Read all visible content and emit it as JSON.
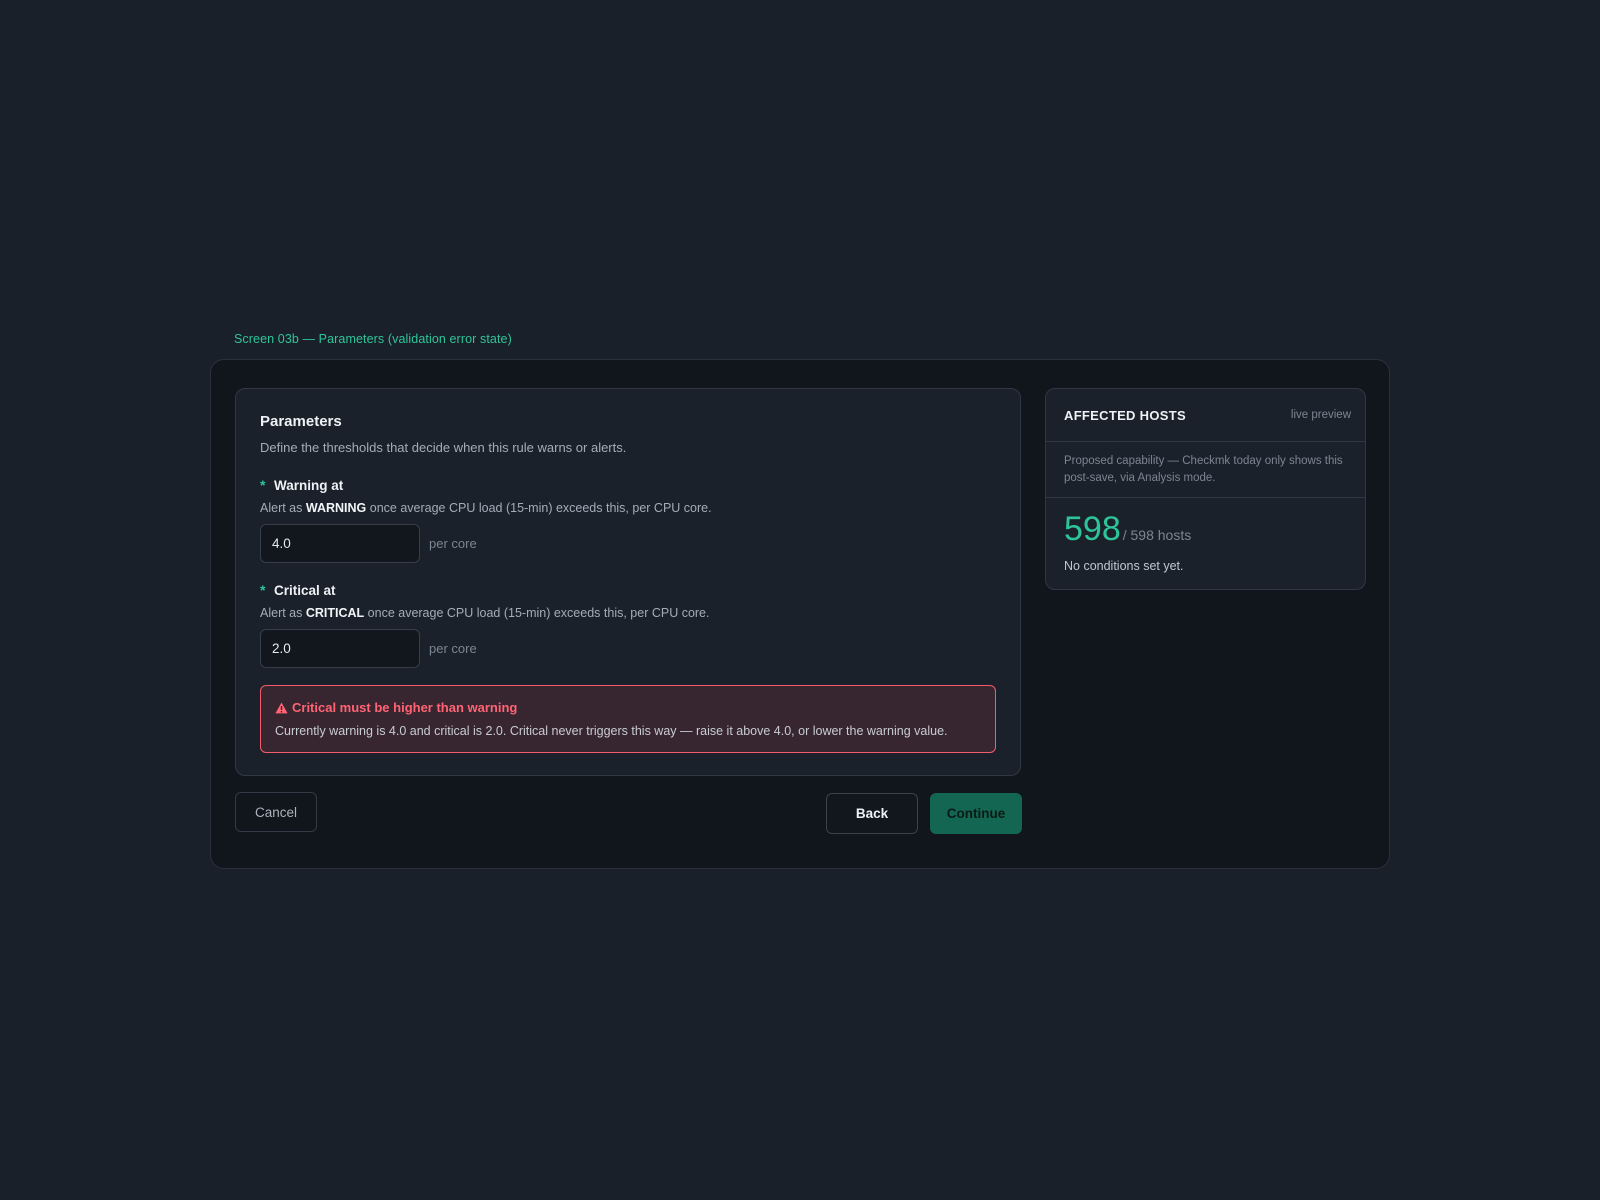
{
  "screen_label": "Screen 03b — Parameters (validation error state)",
  "parameters": {
    "title": "Parameters",
    "description": "Define the thresholds that decide when this rule warns or alerts.",
    "warning": {
      "required_mark": "*",
      "label": "Warning at",
      "help_prefix": "Alert as ",
      "help_level": "WARNING",
      "help_suffix": " once average CPU load (15-min) exceeds this, per CPU core.",
      "value": "4.0",
      "unit": "per core"
    },
    "critical": {
      "required_mark": "*",
      "label": "Critical at",
      "help_prefix": "Alert as ",
      "help_level": "CRITICAL",
      "help_suffix": " once average CPU load (15-min) exceeds this, per CPU core.",
      "value": "2.0",
      "unit": "per core"
    },
    "error": {
      "icon": "warning-triangle-icon",
      "title": "Critical must be higher than warning",
      "message": "Currently warning is 4.0 and critical is 2.0. Critical never triggers this way — raise it above 4.0, or lower the warning value."
    }
  },
  "actions": {
    "cancel_label": "Cancel",
    "back_label": "Back",
    "continue_label": "Continue"
  },
  "affected_hosts": {
    "title": "AFFECTED HOSTS",
    "badge": "live preview",
    "note": "Proposed capability — Checkmk today only shows this post-save, via Analysis mode.",
    "count": "598",
    "total": "/ 598 hosts",
    "status": "No conditions set yet."
  },
  "colors": {
    "accent": "#2ec49a",
    "error": "#ff6474",
    "continue_button": "#136651"
  }
}
